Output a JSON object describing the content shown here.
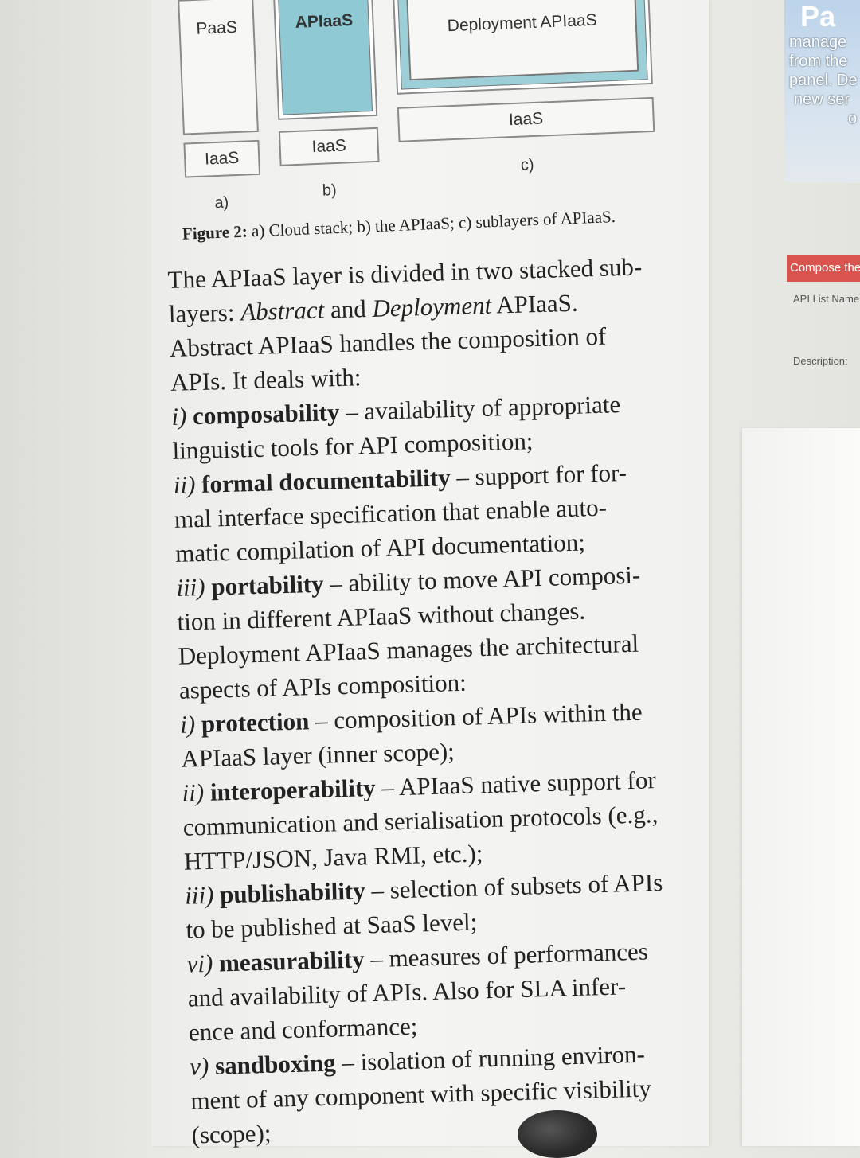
{
  "figure": {
    "a": {
      "top_label": "PaaS",
      "bottom_label": "IaaS",
      "caption": "a)"
    },
    "b": {
      "top_label": "APIaaS",
      "bottom_label": "IaaS",
      "caption": "b)"
    },
    "c": {
      "top_label": "Deployment APIaaS",
      "bottom_label": "IaaS",
      "caption": "c)"
    },
    "caption_bold": "Figure 2:",
    "caption_rest": " a) Cloud stack; b) the APIaaS; c) sublayers of APIaaS.",
    "colors": {
      "apiaas_fill": "#8fc9d4",
      "box_border": "#8a8a8a"
    }
  },
  "body": {
    "intro_1": "The APIaaS layer is divided in two stacked sub-",
    "intro_2a": "layers: ",
    "intro_2b": "Abstract",
    "intro_2c": " and ",
    "intro_2d": "Deployment",
    "intro_2e": " APIaaS.",
    "intro_3": "Abstract APIaaS handles the composition of",
    "intro_4": "APIs. It deals with:",
    "a1_num": "i)",
    "a1_term": "composability",
    "a1_text": " – availability of appropriate",
    "a1_text2": "linguistic tools for API composition;",
    "a2_num": "ii)",
    "a2_term": "formal documentability",
    "a2_text": " – support for for-",
    "a2_text2": "mal interface specification that enable auto-",
    "a2_text3": "matic compilation of API documentation;",
    "a3_num": "iii)",
    "a3_term": "portability",
    "a3_text": " – ability to move API composi-",
    "a3_text2": "tion in different APIaaS without changes.",
    "dep_1": "Deployment APIaaS manages the architectural",
    "dep_2": "aspects of APIs composition:",
    "d1_num": "i)",
    "d1_term": "protection",
    "d1_text": " – composition of APIs within the",
    "d1_text2": "APIaaS layer (inner scope);",
    "d2_num": "ii)",
    "d2_term": "interoperability",
    "d2_text": " – APIaaS native support for",
    "d2_text2": "communication and serialisation protocols (e.g.,",
    "d2_text3": "HTTP/JSON, Java RMI, etc.);",
    "d3_num": "iii)",
    "d3_term": "publishability",
    "d3_text": " – selection of subsets of APIs",
    "d3_text2": "to be published at SaaS level;",
    "d4_num": "vi)",
    "d4_term": "measurability",
    "d4_text": " – measures of performances",
    "d4_text2": "and availability of APIs. Also for SLA infer-",
    "d4_text3": "ence and conformance;",
    "d5_num": "v)",
    "d5_term": "sandboxing",
    "d5_text": " – isolation of running environ-",
    "d5_text2": "ment of any component with specific visibility",
    "d5_text3": "(scope);"
  },
  "right": {
    "heading": "Pa",
    "line1": "manage",
    "line2": "from the",
    "line3": "panel. De",
    "line4": "new ser",
    "line5": "o",
    "compose_button": "Compose the",
    "api_list_label": "API List Name",
    "description_label": "Description:"
  }
}
